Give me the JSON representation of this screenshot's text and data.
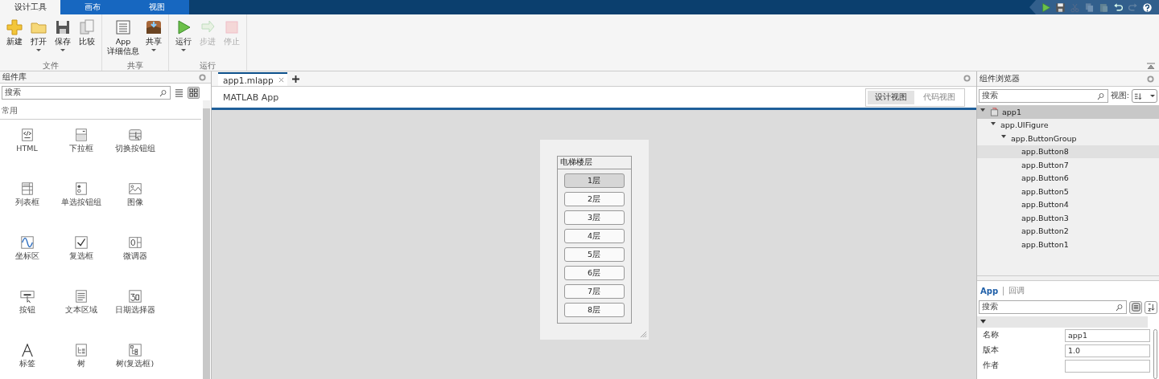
{
  "top_tabs": [
    {
      "label": "设计工具",
      "selected": true
    },
    {
      "label": "画布",
      "selected": false
    },
    {
      "label": "视图",
      "selected": false
    }
  ],
  "quick_access": [
    {
      "kind": "run",
      "disabled": false
    },
    {
      "kind": "save",
      "disabled": false
    },
    {
      "kind": "cut",
      "disabled": true
    },
    {
      "kind": "copy",
      "disabled": true
    },
    {
      "kind": "paste",
      "disabled": true
    },
    {
      "kind": "undo",
      "disabled": false
    },
    {
      "kind": "redo",
      "disabled": true
    },
    {
      "kind": "help",
      "disabled": false
    }
  ],
  "ribbon_groups": [
    {
      "label": "文件",
      "buttons": [
        {
          "label": "新建",
          "kind": "new",
          "disabled": false,
          "dropdown": false
        },
        {
          "label": "打开",
          "kind": "open",
          "disabled": false,
          "dropdown": true
        },
        {
          "label": "保存",
          "kind": "save",
          "disabled": false,
          "dropdown": true
        },
        {
          "label": "比较",
          "kind": "compare",
          "disabled": false,
          "dropdown": false
        }
      ]
    },
    {
      "label": "共享",
      "buttons": [
        {
          "label": "App\n详细信息",
          "kind": "details",
          "disabled": false,
          "dropdown": false
        },
        {
          "label": "共享",
          "kind": "share",
          "disabled": false,
          "dropdown": true
        }
      ]
    },
    {
      "label": "运行",
      "buttons": [
        {
          "label": "运行",
          "kind": "run",
          "disabled": false,
          "dropdown": true
        },
        {
          "label": "步进",
          "kind": "step",
          "disabled": true,
          "dropdown": false
        },
        {
          "label": "停止",
          "kind": "stop",
          "disabled": true,
          "dropdown": false
        }
      ]
    }
  ],
  "library": {
    "title": "组件库",
    "search": {
      "placeholder": "搜索"
    },
    "view_modes": [
      {
        "kind": "list",
        "selected": false
      },
      {
        "kind": "grid",
        "selected": true
      }
    ],
    "section": "常用",
    "items": [
      {
        "label": "HTML",
        "kind": "html"
      },
      {
        "label": "下拉框",
        "kind": "dropdown"
      },
      {
        "label": "切换按钮组",
        "kind": "toggle"
      },
      {
        "label": "列表框",
        "kind": "listbox"
      },
      {
        "label": "单选按钮组",
        "kind": "radio"
      },
      {
        "label": "图像",
        "kind": "image"
      },
      {
        "label": "坐标区",
        "kind": "axes"
      },
      {
        "label": "复选框",
        "kind": "checkbox"
      },
      {
        "label": "微调器",
        "kind": "spinner"
      },
      {
        "label": "按钮",
        "kind": "push"
      },
      {
        "label": "文本区域",
        "kind": "textarea"
      },
      {
        "label": "日期选择器",
        "kind": "date"
      },
      {
        "label": "标签",
        "kind": "label"
      },
      {
        "label": "树",
        "kind": "tree"
      },
      {
        "label": "树(复选框)",
        "kind": "checktree"
      }
    ]
  },
  "editor": {
    "tabs": [
      {
        "label": "app1.mlapp",
        "selected": true
      }
    ],
    "title": "MATLAB App",
    "views": [
      {
        "label": "设计视图",
        "selected": true
      },
      {
        "label": "代码视图",
        "selected": false
      }
    ],
    "figure": {
      "group_title": "电梯楼层",
      "buttons": [
        {
          "label": "1层",
          "selected": true
        },
        {
          "label": "2层",
          "selected": false
        },
        {
          "label": "3层",
          "selected": false
        },
        {
          "label": "4层",
          "selected": false
        },
        {
          "label": "5层",
          "selected": false
        },
        {
          "label": "6层",
          "selected": false
        },
        {
          "label": "7层",
          "selected": false
        },
        {
          "label": "8层",
          "selected": false
        }
      ]
    }
  },
  "browser": {
    "title": "组件浏览器",
    "search": {
      "placeholder": "搜索"
    },
    "view_label": "视图:",
    "tree": [
      {
        "label": "app1",
        "expanded": true,
        "selected": true,
        "hovered": false,
        "children": [
          {
            "label": "app.UIFigure",
            "expanded": true,
            "selected": false,
            "hovered": false,
            "children": [
              {
                "label": "app.ButtonGroup",
                "expanded": true,
                "selected": false,
                "hovered": false,
                "children": [
                  {
                    "label": "app.Button8",
                    "selected": false,
                    "hovered": true
                  },
                  {
                    "label": "app.Button7",
                    "selected": false,
                    "hovered": false
                  },
                  {
                    "label": "app.Button6",
                    "selected": false,
                    "hovered": false
                  },
                  {
                    "label": "app.Button5",
                    "selected": false,
                    "hovered": false
                  },
                  {
                    "label": "app.Button4",
                    "selected": false,
                    "hovered": false
                  },
                  {
                    "label": "app.Button3",
                    "selected": false,
                    "hovered": false
                  },
                  {
                    "label": "app.Button2",
                    "selected": false,
                    "hovered": false
                  },
                  {
                    "label": "app.Button1",
                    "selected": false,
                    "hovered": false
                  }
                ]
              }
            ]
          }
        ]
      }
    ],
    "inspector_tabs": [
      {
        "label": "App",
        "selected": true
      },
      {
        "label": "回调",
        "selected": false
      }
    ],
    "inspector_search": {
      "placeholder": "搜索"
    },
    "properties": [
      {
        "name": "名称",
        "value": "app1"
      },
      {
        "name": "版本",
        "value": "1.0"
      },
      {
        "name": "作者"
      }
    ]
  }
}
